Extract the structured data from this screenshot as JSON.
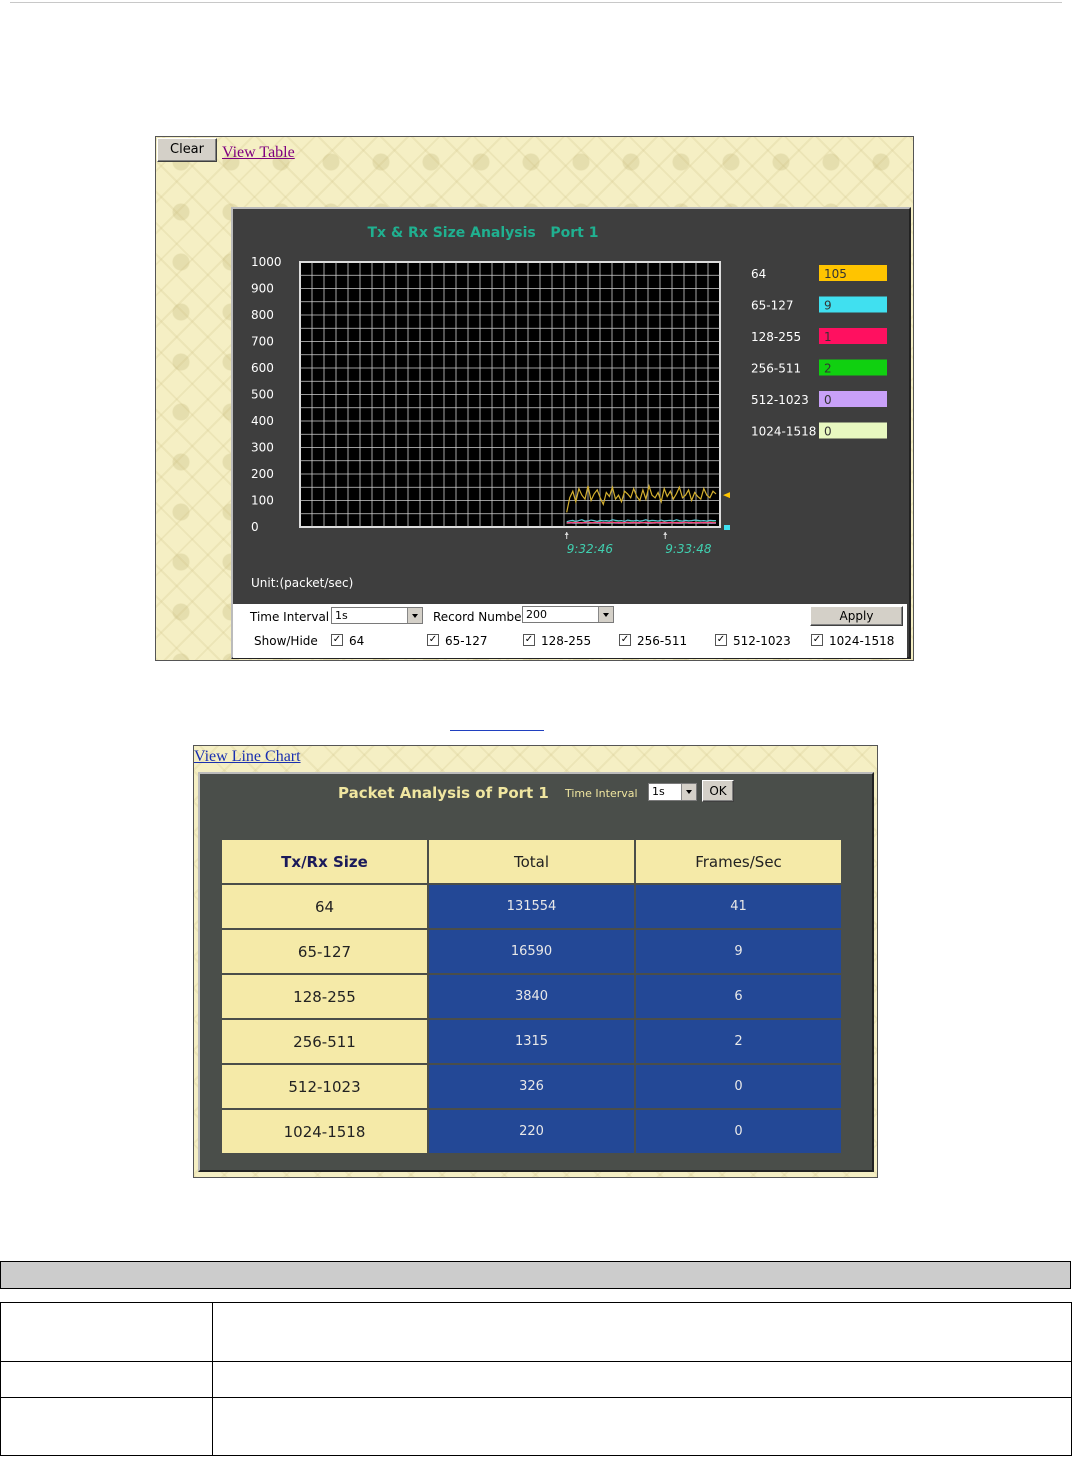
{
  "panel1": {
    "clear_label": "Clear",
    "view_table_label": "View Table",
    "unit_label": "Unit:(packet/sec)",
    "controls": {
      "time_interval_label": "Time Interval",
      "time_interval_value": "1s",
      "record_number_label": "Record Number",
      "record_number_value": "200",
      "apply_label": "Apply",
      "show_hide_label": "Show/Hide",
      "checkboxes": [
        "64",
        "65-127",
        "128-255",
        "256-511",
        "512-1023",
        "1024-1518"
      ]
    }
  },
  "chart_data": {
    "type": "line",
    "title": "Tx & Rx Size Analysis   Port 1",
    "ylabel": "Unit:(packet/sec)",
    "ylim": [
      0,
      1000
    ],
    "yticks": [
      1000,
      900,
      800,
      700,
      600,
      500,
      400,
      300,
      200,
      100,
      0
    ],
    "xtick_labels": [
      "9:32:46",
      "9:33:48"
    ],
    "grid": true,
    "legend_position": "right",
    "legend": [
      {
        "name": "64",
        "value": "105",
        "color": "#ffc400"
      },
      {
        "name": "65-127",
        "value": "9",
        "color": "#40e0f0"
      },
      {
        "name": "128-255",
        "value": "1",
        "color": "#ff1060"
      },
      {
        "name": "256-511",
        "value": "2",
        "color": "#10d010"
      },
      {
        "name": "512-1023",
        "value": "0",
        "color": "#c8a0f8"
      },
      {
        "name": "1024-1518",
        "value": "0",
        "color": "#e8f8c0"
      }
    ],
    "series": [
      {
        "name": "64",
        "color": "#d4b030",
        "values": [
          40,
          95,
          120,
          80,
          130,
          105,
          90,
          140,
          85,
          110,
          125,
          95,
          70,
          115,
          100,
          135,
          90,
          105,
          80,
          120,
          110,
          95,
          130,
          100,
          85,
          125,
          90,
          140,
          105,
          95,
          115,
          80,
          130,
          100,
          120,
          90,
          110,
          135,
          95,
          105,
          125,
          85,
          115,
          100,
          90,
          130,
          105,
          95,
          120,
          110
        ]
      },
      {
        "name": "65-127",
        "color": "#60c8d8",
        "values": [
          5,
          8,
          10,
          6,
          9,
          12,
          7,
          8,
          11,
          9,
          6,
          10,
          8,
          9,
          7,
          12,
          10,
          8,
          9,
          6,
          11,
          9,
          8,
          10,
          7,
          9,
          12,
          8,
          10,
          9,
          7,
          11,
          8,
          9,
          10,
          8,
          12,
          9,
          7,
          10,
          8,
          9,
          11,
          10,
          8,
          9,
          7,
          10,
          9,
          9
        ]
      },
      {
        "name": "128-255",
        "color": "#ff4080",
        "values": [
          1,
          2,
          1,
          3,
          2,
          1,
          2,
          4,
          1,
          2,
          3,
          1,
          2,
          1,
          2,
          3,
          1,
          2,
          1,
          2,
          3,
          1,
          2,
          1,
          2,
          1,
          3,
          2,
          1,
          2,
          1,
          2,
          3,
          1,
          2,
          1,
          2,
          1,
          2,
          3,
          1,
          2,
          1,
          2,
          1,
          2,
          1,
          3,
          1,
          1
        ]
      },
      {
        "name": "256-511",
        "color": "#30d030",
        "values": [
          2,
          1,
          3,
          2,
          1,
          2,
          3,
          2,
          1,
          2,
          2,
          3,
          1,
          2,
          2,
          1,
          3,
          2,
          2,
          1,
          2,
          3,
          2,
          1,
          2,
          2,
          1,
          3,
          2,
          2,
          1,
          2,
          3,
          2,
          1,
          2,
          2,
          3,
          1,
          2,
          2,
          1,
          2,
          3,
          2,
          1,
          2,
          2,
          3,
          2
        ]
      },
      {
        "name": "512-1023",
        "color": "#c8a0f8",
        "values": [
          0,
          1,
          0,
          0,
          1,
          0,
          1,
          0,
          0,
          1,
          0,
          0,
          1,
          0,
          0,
          1,
          0,
          0,
          0,
          1,
          0,
          0,
          1,
          0,
          0,
          1,
          0,
          0,
          0,
          1,
          0,
          0,
          1,
          0,
          0,
          1,
          0,
          0,
          0,
          1,
          0,
          0,
          1,
          0,
          0,
          0,
          1,
          0,
          0,
          0
        ]
      },
      {
        "name": "1024-1518",
        "color": "#e8f8c0",
        "values": [
          0,
          0,
          1,
          0,
          0,
          0,
          1,
          0,
          0,
          0,
          0,
          1,
          0,
          0,
          0,
          0,
          1,
          0,
          0,
          0,
          1,
          0,
          0,
          0,
          0,
          1,
          0,
          0,
          0,
          0,
          1,
          0,
          0,
          0,
          1,
          0,
          0,
          0,
          0,
          1,
          0,
          0,
          0,
          0,
          1,
          0,
          0,
          0,
          0,
          0
        ]
      }
    ]
  },
  "middle_link": "",
  "panel2": {
    "view_line_chart_label": "View Line Chart",
    "title": "Packet Analysis of Port 1",
    "time_interval_label": "Time Interval",
    "time_interval_value": "1s",
    "ok_label": "OK",
    "headers": [
      "Tx/Rx Size",
      "Total",
      "Frames/Sec"
    ],
    "rows": [
      [
        "64",
        "131554",
        "41"
      ],
      [
        "65-127",
        "16590",
        "9"
      ],
      [
        "128-255",
        "3840",
        "6"
      ],
      [
        "256-511",
        "1315",
        "2"
      ],
      [
        "512-1023",
        "326",
        "0"
      ],
      [
        "1024-1518",
        "220",
        "0"
      ]
    ]
  }
}
